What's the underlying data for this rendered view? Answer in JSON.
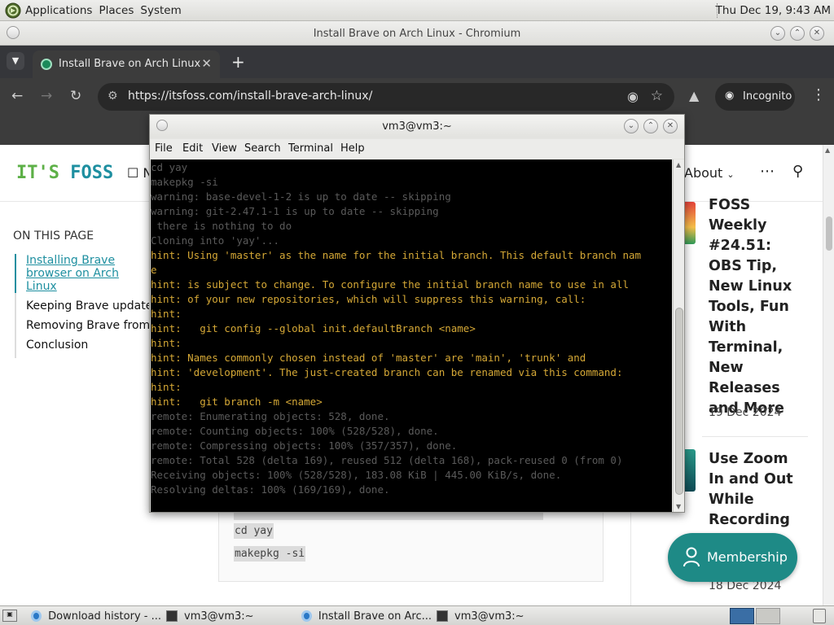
{
  "top_panel": {
    "menus": [
      "Applications",
      "Places",
      "System"
    ],
    "clock": "Thu Dec 19,  9:43 AM"
  },
  "browser": {
    "window_title": "Install Brave on Arch Linux - Chromium",
    "tab_label": "Install Brave on Arch Linux",
    "url": "https://itsfoss.com/install-brave-arch-linux/",
    "incognito_label": "Incognito"
  },
  "page": {
    "logo_part1": "IT'S ",
    "logo_part2": "FOSS",
    "nav_news": "☐ N",
    "nav_about": "About",
    "toc_title": "ON THIS PAGE",
    "toc": [
      "Installing Brave browser on Arch Linux",
      "Keeping Brave updated",
      "Removing Brave from Arch",
      "Conclusion"
    ],
    "code_lines": [
      "cd yay",
      "makepkg -si"
    ],
    "sidebar": [
      {
        "title": "FOSS Weekly #24.51: OBS Tip, New Linux Tools, Fun With Terminal, New Releases and More",
        "date": "19 Dec 2024"
      },
      {
        "title": "Use Zoom In and Out While Recording",
        "date": "18 Dec 2024"
      }
    ],
    "membership_label": "Membership"
  },
  "terminal": {
    "title": "vm3@vm3:~",
    "menu": [
      "File",
      "Edit",
      "View",
      "Search",
      "Terminal",
      "Help"
    ],
    "lines": [
      {
        "t": "cd yay",
        "k": "dim"
      },
      {
        "t": "makepkg -si",
        "k": "dim"
      },
      {
        "t": "warning: base-devel-1-2 is up to date -- skipping",
        "k": "dim"
      },
      {
        "t": "warning: git-2.47.1-1 is up to date -- skipping",
        "k": "dim"
      },
      {
        "t": " there is nothing to do",
        "k": "dim"
      },
      {
        "t": "Cloning into 'yay'...",
        "k": "dim"
      },
      {
        "t": "hint: Using 'master' as the name for the initial branch. This default branch nam",
        "k": "hint"
      },
      {
        "t": "e",
        "k": "hint"
      },
      {
        "t": "hint: is subject to change. To configure the initial branch name to use in all",
        "k": "hint"
      },
      {
        "t": "hint: of your new repositories, which will suppress this warning, call:",
        "k": "hint"
      },
      {
        "t": "hint:",
        "k": "hint"
      },
      {
        "t": "hint:   git config --global init.defaultBranch <name>",
        "k": "hint"
      },
      {
        "t": "hint:",
        "k": "hint"
      },
      {
        "t": "hint: Names commonly chosen instead of 'master' are 'main', 'trunk' and",
        "k": "hint"
      },
      {
        "t": "hint: 'development'. The just-created branch can be renamed via this command:",
        "k": "hint"
      },
      {
        "t": "hint:",
        "k": "hint"
      },
      {
        "t": "hint:   git branch -m <name>",
        "k": "hint"
      },
      {
        "t": "remote: Enumerating objects: 528, done.",
        "k": "dim"
      },
      {
        "t": "remote: Counting objects: 100% (528/528), done.",
        "k": "dim"
      },
      {
        "t": "remote: Compressing objects: 100% (357/357), done.",
        "k": "dim"
      },
      {
        "t": "remote: Total 528 (delta 169), reused 512 (delta 168), pack-reused 0 (from 0)",
        "k": "dim"
      },
      {
        "t": "Receiving objects: 100% (528/528), 183.08 KiB | 445.00 KiB/s, done.",
        "k": "dim"
      },
      {
        "t": "Resolving deltas: 100% (169/169), done.",
        "k": "dim"
      }
    ]
  },
  "taskbar": {
    "items": [
      "Download history - ...",
      "vm3@vm3:~",
      "Install Brave on Arc...",
      "vm3@vm3:~"
    ]
  }
}
